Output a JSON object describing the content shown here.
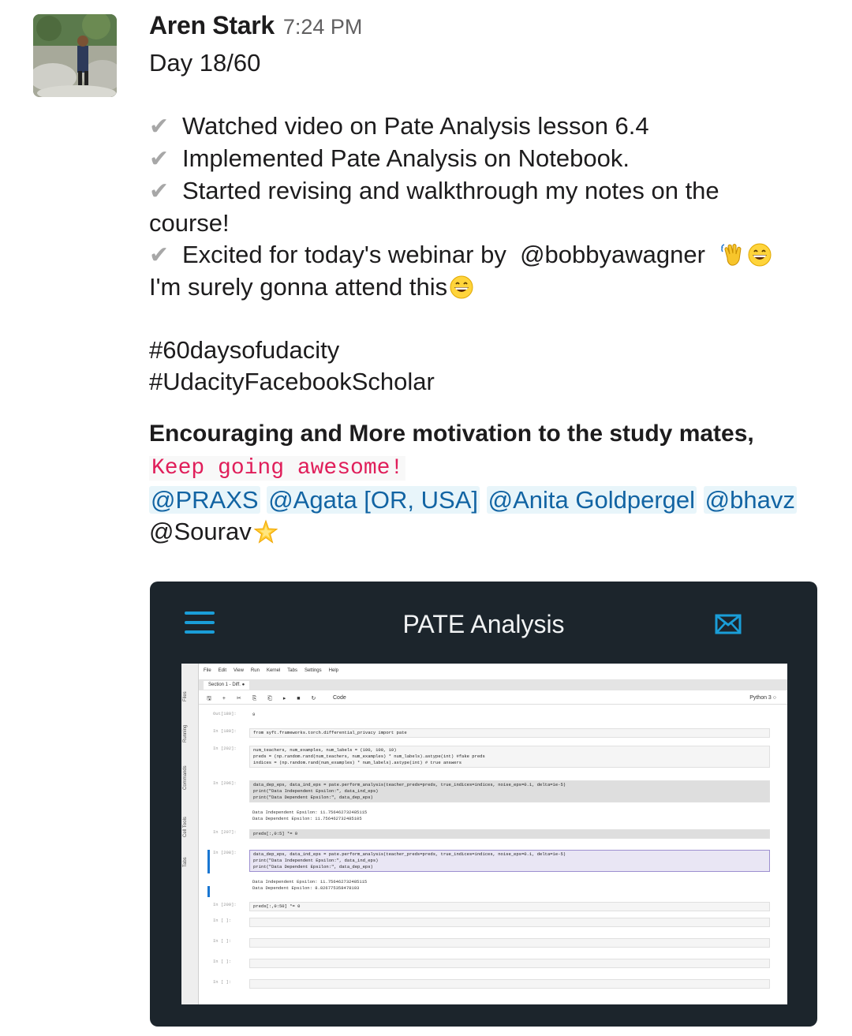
{
  "message": {
    "author": "Aren Stark",
    "time": "7:24 PM",
    "day": "Day 18/60",
    "checklist": [
      "Watched video on Pate Analysis lesson 6.4",
      "Implemented Pate Analysis on Notebook.",
      "Started revising and walkthrough my notes on the",
      "course!",
      "Excited for today's webinar by",
      "@bobbyawagner",
      "I'm surely gonna attend this"
    ],
    "hashtags": [
      "#60daysofudacity",
      "#UdacityFacebookScholar"
    ],
    "encourage": "Encouraging and More motivation to the study mates,",
    "code_text": "Keep going awesome!",
    "mentions": [
      "@PRAXS",
      "@Agata [OR, USA]",
      "@Anita Goldpergel",
      "@bhavz",
      "@Sourav"
    ],
    "check_glyph": "✔",
    "emoji": [
      "waving-hand",
      "grinning-face",
      "grinning-face",
      "glowing-star"
    ]
  },
  "attachment": {
    "app_title": "PATE Analysis",
    "icons": [
      "hamburger-menu-icon",
      "mail-icon"
    ],
    "accent_color": "#1a9ed8",
    "notebook": {
      "menu": [
        "File",
        "Edit",
        "View",
        "Run",
        "Kernel",
        "Tabs",
        "Settings",
        "Help"
      ],
      "side_tabs": [
        "Files",
        "Running",
        "Commands",
        "Cell Tools",
        "Tabs"
      ],
      "tab": "Section 1 - Diff. ●",
      "tool_glyphs": "🖫 + ✂ ⎘ ⎗ ▸ ■ ↻",
      "cell_type": "Code",
      "kernel": "Python 3 ○",
      "cells": [
        {
          "prompt": "Out[180]:",
          "lines": [
            "9"
          ],
          "out": true
        },
        {
          "prompt": "In [180]:",
          "lines": [
            "from syft.frameworks.torch.differential_privacy import pate"
          ]
        },
        {
          "prompt": "In [202]:",
          "lines": [
            "num_teachers, num_examples, num_labels = (100, 100, 10)",
            "preds = (np.random.rand(num_teachers, num_examples) * num_labels).astype(int) #fake preds",
            "indices = (np.random.rand(num_examples) * num_labels).astype(int) # true answers"
          ]
        },
        {
          "prompt": "In [206]:",
          "lines": [
            "data_dep_eps, data_ind_eps = pate.perform_analysis(teacher_preds=preds, true_indices=indices, noise_eps=0.1, delta=1e-5)",
            "print(\"Data Independent Epsilon:\", data_ind_eps)",
            "print(\"Data Dependent Epsilon:\", data_dep_eps)"
          ],
          "grey": true
        },
        {
          "prompt": "",
          "lines": [
            "Data Independent Epsilon: 11.756462732485115",
            "Data Dependent Epsilon: 11.756462732485105"
          ],
          "out": true
        },
        {
          "prompt": "In [207]:",
          "lines": [
            "preds[:,0:5] *= 0"
          ],
          "grey": true
        },
        {
          "prompt": "In [208]:",
          "lines": [
            "data_dep_eps, data_ind_eps = pate.perform_analysis(teacher_preds=preds, true_indices=indices, noise_eps=0.1, delta=1e-5)",
            "print(\"Data Independent Epsilon:\", data_ind_eps)",
            "print(\"Data Dependent Epsilon:\", data_dep_eps)"
          ],
          "sel": true
        },
        {
          "prompt": "",
          "lines": [
            "Data Independent Epsilon: 11.756462732485115",
            "Data Dependent Epsilon: 8.826775358478103"
          ],
          "out": true
        },
        {
          "prompt": "In [209]:",
          "lines": [
            "preds[:,0:50] *= 0"
          ]
        },
        {
          "prompt": "In [ ]:",
          "lines": [
            ""
          ]
        },
        {
          "prompt": "In [ ]:",
          "lines": [
            ""
          ]
        },
        {
          "prompt": "In [ ]:",
          "lines": [
            ""
          ]
        },
        {
          "prompt": "In [ ]:",
          "lines": [
            ""
          ]
        }
      ]
    }
  }
}
